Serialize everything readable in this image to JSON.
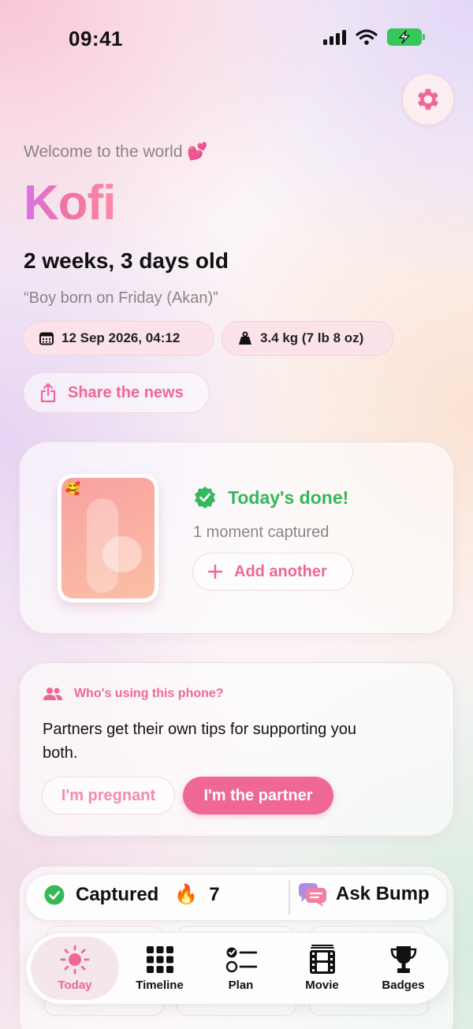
{
  "status_bar": {
    "time": "09:41"
  },
  "header": {
    "welcome": "Welcome to the world",
    "welcome_emoji": "💕",
    "baby_name": "Kofi",
    "age": "2 weeks, 3 days old",
    "name_meaning": "“Boy born on Friday (Akan)”",
    "birth_datetime": "12 Sep 2026, 04:12",
    "birth_weight": "3.4 kg (7 lb 8 oz)",
    "share_label": "Share the news"
  },
  "moment_card": {
    "photo_emoji": "🥰",
    "done_label": "Today's done!",
    "count_label": "1 moment captured",
    "add_label": "Add another"
  },
  "phone_card": {
    "question": "Who's using this phone?",
    "description": "Partners get their own tips for supporting you both.",
    "option_pregnant": "I'm pregnant",
    "option_partner": "I'm the partner"
  },
  "summary_bar": {
    "captured_label": "Captured",
    "streak_emoji": "🔥",
    "streak_count": "7",
    "ask_label": "Ask Bump"
  },
  "tabs": [
    {
      "label": "Today",
      "icon": "sun-icon",
      "active": true
    },
    {
      "label": "Timeline",
      "icon": "grid-icon",
      "active": false
    },
    {
      "label": "Plan",
      "icon": "checklist-icon",
      "active": false
    },
    {
      "label": "Movie",
      "icon": "film-icon",
      "active": false
    },
    {
      "label": "Badges",
      "icon": "trophy-icon",
      "active": false
    }
  ],
  "colors": {
    "accent_pink": "#ef6796",
    "success_green": "#34b85a",
    "battery_green": "#34c759"
  }
}
